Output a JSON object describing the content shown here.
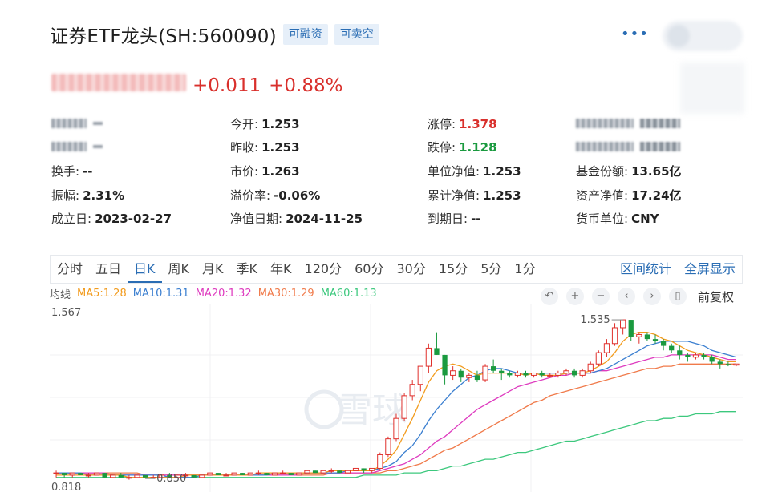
{
  "header": {
    "title": "证券ETF龙头(SH:560090)",
    "tags": [
      "可融资",
      "可卖空"
    ],
    "more": "•••"
  },
  "quote": {
    "change": "+0.011",
    "change_pct": "+0.88%"
  },
  "stats": {
    "open_label": "今开:",
    "open": "1.253",
    "limit_up_label": "涨停:",
    "limit_up": "1.378",
    "prev_close_label": "昨收:",
    "prev_close": "1.253",
    "limit_down_label": "跌停:",
    "limit_down": "1.128",
    "turnover_label": "换手:",
    "turnover": "--",
    "market_price_label": "市价:",
    "market_price": "1.263",
    "unit_nav_label": "单位净值:",
    "unit_nav": "1.253",
    "fund_shares_label": "基金份额:",
    "fund_shares": "13.65亿",
    "amplitude_label": "振幅:",
    "amplitude": "2.31%",
    "premium_label": "溢价率:",
    "premium": "-0.06%",
    "cum_nav_label": "累计净值:",
    "cum_nav": "1.253",
    "net_assets_label": "资产净值:",
    "net_assets": "17.24亿",
    "inception_label": "成立日:",
    "inception": "2023-02-27",
    "nav_date_label": "净值日期:",
    "nav_date": "2024-11-25",
    "maturity_label": "到期日:",
    "maturity": "--",
    "currency_label": "货币单位:",
    "currency": "CNY"
  },
  "tabs": [
    "分时",
    "五日",
    "日K",
    "周K",
    "月K",
    "季K",
    "年K",
    "120分",
    "60分",
    "30分",
    "15分",
    "5分",
    "1分"
  ],
  "active_tab": "日K",
  "tab_actions": [
    "区间统计",
    "全屏显示"
  ],
  "legend": {
    "title": "均线",
    "ma5": "MA5:1.28",
    "ma10": "MA10:1.31",
    "ma20": "MA20:1.32",
    "ma30": "MA30:1.29",
    "ma60": "MA60:1.13"
  },
  "toolbar": {
    "icons": [
      "undo-icon",
      "zoom-in-icon",
      "zoom-out-icon",
      "scroll-left-icon",
      "scroll-right-icon",
      "candle-icon"
    ],
    "adjust": "前复权"
  },
  "colors": {
    "up": "#e0302c",
    "down": "#1a9a3f",
    "ma5": "#f29b1d",
    "ma10": "#3b7fd0",
    "ma20": "#de3bbf",
    "ma30": "#f07a4a",
    "ma60": "#3cc87d",
    "accent": "#2a6db4"
  },
  "chart_data": {
    "type": "candlestick",
    "ylim": [
      0.818,
      1.567
    ],
    "labels": {
      "top": "1.567",
      "bottom": "0.818",
      "low_mark": "0.850",
      "high_mark": "1.535"
    },
    "watermark": "雪球",
    "candles": [
      [
        0.86,
        0.87,
        0.84,
        0.86
      ],
      [
        0.86,
        0.86,
        0.84,
        0.85
      ],
      [
        0.85,
        0.86,
        0.84,
        0.86
      ],
      [
        0.86,
        0.86,
        0.85,
        0.85
      ],
      [
        0.85,
        0.86,
        0.84,
        0.85
      ],
      [
        0.85,
        0.86,
        0.85,
        0.86
      ],
      [
        0.86,
        0.86,
        0.84,
        0.84
      ],
      [
        0.84,
        0.85,
        0.84,
        0.85
      ],
      [
        0.85,
        0.86,
        0.84,
        0.84
      ],
      [
        0.84,
        0.85,
        0.83,
        0.84
      ],
      [
        0.84,
        0.85,
        0.84,
        0.85
      ],
      [
        0.85,
        0.85,
        0.84,
        0.84
      ],
      [
        0.84,
        0.85,
        0.84,
        0.84
      ],
      [
        0.84,
        0.85,
        0.84,
        0.85
      ],
      [
        0.85,
        0.86,
        0.84,
        0.84
      ],
      [
        0.84,
        0.85,
        0.84,
        0.85
      ],
      [
        0.85,
        0.86,
        0.84,
        0.85
      ],
      [
        0.85,
        0.85,
        0.84,
        0.84
      ],
      [
        0.84,
        0.85,
        0.84,
        0.85
      ],
      [
        0.85,
        0.86,
        0.85,
        0.86
      ],
      [
        0.86,
        0.86,
        0.85,
        0.85
      ],
      [
        0.85,
        0.86,
        0.85,
        0.85
      ],
      [
        0.85,
        0.86,
        0.85,
        0.86
      ],
      [
        0.86,
        0.86,
        0.85,
        0.85
      ],
      [
        0.85,
        0.86,
        0.85,
        0.86
      ],
      [
        0.86,
        0.87,
        0.85,
        0.86
      ],
      [
        0.86,
        0.86,
        0.85,
        0.85
      ],
      [
        0.85,
        0.86,
        0.85,
        0.86
      ],
      [
        0.86,
        0.87,
        0.86,
        0.86
      ],
      [
        0.86,
        0.86,
        0.85,
        0.85
      ],
      [
        0.85,
        0.86,
        0.85,
        0.86
      ],
      [
        0.86,
        0.87,
        0.86,
        0.87
      ],
      [
        0.87,
        0.87,
        0.86,
        0.86
      ],
      [
        0.86,
        0.87,
        0.86,
        0.87
      ],
      [
        0.87,
        0.88,
        0.86,
        0.87
      ],
      [
        0.87,
        0.87,
        0.86,
        0.86
      ],
      [
        0.86,
        0.87,
        0.86,
        0.87
      ],
      [
        0.87,
        0.88,
        0.87,
        0.88
      ],
      [
        0.88,
        0.88,
        0.86,
        0.87
      ],
      [
        0.87,
        0.88,
        0.86,
        0.88
      ],
      [
        0.88,
        0.95,
        0.87,
        0.94
      ],
      [
        0.94,
        1.02,
        0.93,
        1.01
      ],
      [
        1.01,
        1.12,
        1.0,
        1.1
      ],
      [
        1.1,
        1.21,
        1.09,
        1.2
      ],
      [
        1.2,
        1.27,
        1.18,
        1.25
      ],
      [
        1.25,
        1.33,
        1.22,
        1.33
      ],
      [
        1.33,
        1.43,
        1.3,
        1.41
      ],
      [
        1.41,
        1.48,
        1.38,
        1.38
      ],
      [
        1.38,
        1.38,
        1.25,
        1.29
      ],
      [
        1.29,
        1.33,
        1.27,
        1.31
      ],
      [
        1.31,
        1.32,
        1.26,
        1.28
      ],
      [
        1.28,
        1.3,
        1.26,
        1.29
      ],
      [
        1.29,
        1.31,
        1.26,
        1.27
      ],
      [
        1.27,
        1.34,
        1.26,
        1.33
      ],
      [
        1.33,
        1.36,
        1.3,
        1.31
      ],
      [
        1.31,
        1.32,
        1.27,
        1.3
      ],
      [
        1.3,
        1.31,
        1.28,
        1.29
      ],
      [
        1.29,
        1.31,
        1.28,
        1.3
      ],
      [
        1.3,
        1.31,
        1.28,
        1.29
      ],
      [
        1.29,
        1.3,
        1.28,
        1.3
      ],
      [
        1.3,
        1.31,
        1.28,
        1.29
      ],
      [
        1.29,
        1.3,
        1.28,
        1.29
      ],
      [
        1.29,
        1.31,
        1.28,
        1.3
      ],
      [
        1.3,
        1.32,
        1.29,
        1.31
      ],
      [
        1.31,
        1.32,
        1.28,
        1.29
      ],
      [
        1.29,
        1.32,
        1.28,
        1.31
      ],
      [
        1.31,
        1.35,
        1.3,
        1.34
      ],
      [
        1.34,
        1.4,
        1.33,
        1.39
      ],
      [
        1.39,
        1.45,
        1.37,
        1.43
      ],
      [
        1.43,
        1.52,
        1.42,
        1.5
      ],
      [
        1.5,
        1.535,
        1.47,
        1.535
      ],
      [
        1.535,
        1.535,
        1.44,
        1.46
      ],
      [
        1.46,
        1.48,
        1.43,
        1.47
      ],
      [
        1.47,
        1.48,
        1.44,
        1.45
      ],
      [
        1.45,
        1.47,
        1.43,
        1.44
      ],
      [
        1.44,
        1.45,
        1.4,
        1.42
      ],
      [
        1.42,
        1.43,
        1.39,
        1.4
      ],
      [
        1.4,
        1.42,
        1.36,
        1.38
      ],
      [
        1.38,
        1.39,
        1.35,
        1.37
      ],
      [
        1.37,
        1.39,
        1.36,
        1.38
      ],
      [
        1.38,
        1.39,
        1.36,
        1.37
      ],
      [
        1.37,
        1.38,
        1.34,
        1.35
      ],
      [
        1.35,
        1.36,
        1.32,
        1.34
      ],
      [
        1.34,
        1.35,
        1.33,
        1.335
      ],
      [
        1.335,
        1.34,
        1.33,
        1.34
      ]
    ],
    "ma5": [
      0.85,
      0.85,
      0.85,
      0.85,
      0.85,
      0.85,
      0.85,
      0.85,
      0.85,
      0.84,
      0.84,
      0.84,
      0.84,
      0.84,
      0.84,
      0.84,
      0.85,
      0.85,
      0.85,
      0.85,
      0.85,
      0.85,
      0.85,
      0.85,
      0.85,
      0.86,
      0.86,
      0.86,
      0.86,
      0.86,
      0.86,
      0.86,
      0.86,
      0.86,
      0.87,
      0.87,
      0.87,
      0.87,
      0.87,
      0.87,
      0.89,
      0.92,
      0.96,
      1.03,
      1.1,
      1.18,
      1.26,
      1.31,
      1.33,
      1.34,
      1.33,
      1.31,
      1.29,
      1.3,
      1.3,
      1.3,
      1.3,
      1.3,
      1.29,
      1.3,
      1.29,
      1.29,
      1.29,
      1.3,
      1.3,
      1.3,
      1.31,
      1.33,
      1.35,
      1.39,
      1.44,
      1.47,
      1.48,
      1.48,
      1.47,
      1.45,
      1.44,
      1.42,
      1.4,
      1.39,
      1.38,
      1.37,
      1.36,
      1.35,
      1.35
    ],
    "ma10": [
      0.86,
      0.86,
      0.86,
      0.86,
      0.85,
      0.85,
      0.85,
      0.85,
      0.85,
      0.85,
      0.85,
      0.85,
      0.85,
      0.85,
      0.84,
      0.84,
      0.84,
      0.84,
      0.85,
      0.85,
      0.85,
      0.85,
      0.85,
      0.85,
      0.85,
      0.85,
      0.85,
      0.86,
      0.86,
      0.86,
      0.86,
      0.86,
      0.86,
      0.86,
      0.86,
      0.86,
      0.87,
      0.87,
      0.87,
      0.87,
      0.88,
      0.89,
      0.91,
      0.95,
      0.98,
      1.03,
      1.09,
      1.14,
      1.18,
      1.22,
      1.25,
      1.28,
      1.29,
      1.31,
      1.32,
      1.32,
      1.31,
      1.3,
      1.3,
      1.3,
      1.3,
      1.3,
      1.3,
      1.3,
      1.3,
      1.3,
      1.3,
      1.31,
      1.32,
      1.34,
      1.36,
      1.38,
      1.4,
      1.42,
      1.43,
      1.44,
      1.44,
      1.44,
      1.44,
      1.43,
      1.42,
      1.4,
      1.39,
      1.38,
      1.37
    ],
    "ma20": [
      0.86,
      0.86,
      0.86,
      0.86,
      0.86,
      0.86,
      0.86,
      0.85,
      0.85,
      0.85,
      0.85,
      0.85,
      0.85,
      0.85,
      0.85,
      0.85,
      0.85,
      0.85,
      0.85,
      0.85,
      0.85,
      0.85,
      0.85,
      0.85,
      0.85,
      0.85,
      0.85,
      0.85,
      0.85,
      0.85,
      0.85,
      0.86,
      0.86,
      0.86,
      0.86,
      0.86,
      0.86,
      0.86,
      0.86,
      0.86,
      0.87,
      0.88,
      0.89,
      0.9,
      0.92,
      0.94,
      0.97,
      1.0,
      1.02,
      1.05,
      1.08,
      1.11,
      1.14,
      1.16,
      1.18,
      1.2,
      1.22,
      1.24,
      1.25,
      1.26,
      1.27,
      1.28,
      1.29,
      1.29,
      1.3,
      1.3,
      1.3,
      1.31,
      1.31,
      1.32,
      1.33,
      1.34,
      1.35,
      1.36,
      1.37,
      1.37,
      1.38,
      1.38,
      1.38,
      1.38,
      1.38,
      1.38,
      1.37,
      1.36,
      1.36
    ],
    "ma30": [
      0.86,
      0.86,
      0.86,
      0.86,
      0.86,
      0.86,
      0.86,
      0.86,
      0.86,
      0.86,
      0.86,
      0.85,
      0.85,
      0.85,
      0.85,
      0.85,
      0.85,
      0.85,
      0.85,
      0.85,
      0.85,
      0.85,
      0.85,
      0.85,
      0.85,
      0.85,
      0.85,
      0.85,
      0.85,
      0.85,
      0.85,
      0.85,
      0.85,
      0.85,
      0.86,
      0.86,
      0.86,
      0.86,
      0.86,
      0.86,
      0.86,
      0.87,
      0.87,
      0.88,
      0.89,
      0.9,
      0.92,
      0.94,
      0.96,
      0.97,
      0.99,
      1.01,
      1.03,
      1.05,
      1.07,
      1.09,
      1.11,
      1.13,
      1.15,
      1.17,
      1.18,
      1.2,
      1.21,
      1.22,
      1.23,
      1.24,
      1.25,
      1.26,
      1.27,
      1.28,
      1.29,
      1.3,
      1.31,
      1.32,
      1.32,
      1.33,
      1.33,
      1.34,
      1.34,
      1.34,
      1.34,
      1.34,
      1.34,
      1.34,
      1.34
    ],
    "ma60": [
      0.84,
      0.84,
      0.84,
      0.84,
      0.84,
      0.84,
      0.84,
      0.84,
      0.84,
      0.84,
      0.84,
      0.84,
      0.84,
      0.84,
      0.84,
      0.84,
      0.84,
      0.84,
      0.84,
      0.84,
      0.84,
      0.84,
      0.84,
      0.84,
      0.84,
      0.84,
      0.84,
      0.84,
      0.84,
      0.84,
      0.84,
      0.84,
      0.84,
      0.84,
      0.84,
      0.84,
      0.84,
      0.84,
      0.85,
      0.85,
      0.85,
      0.85,
      0.85,
      0.86,
      0.86,
      0.86,
      0.87,
      0.87,
      0.88,
      0.89,
      0.89,
      0.9,
      0.91,
      0.92,
      0.92,
      0.93,
      0.94,
      0.95,
      0.95,
      0.96,
      0.97,
      0.98,
      0.99,
      1.0,
      1.0,
      1.01,
      1.02,
      1.03,
      1.04,
      1.05,
      1.06,
      1.07,
      1.08,
      1.09,
      1.09,
      1.1,
      1.1,
      1.11,
      1.11,
      1.12,
      1.12,
      1.12,
      1.13,
      1.13,
      1.13
    ]
  }
}
